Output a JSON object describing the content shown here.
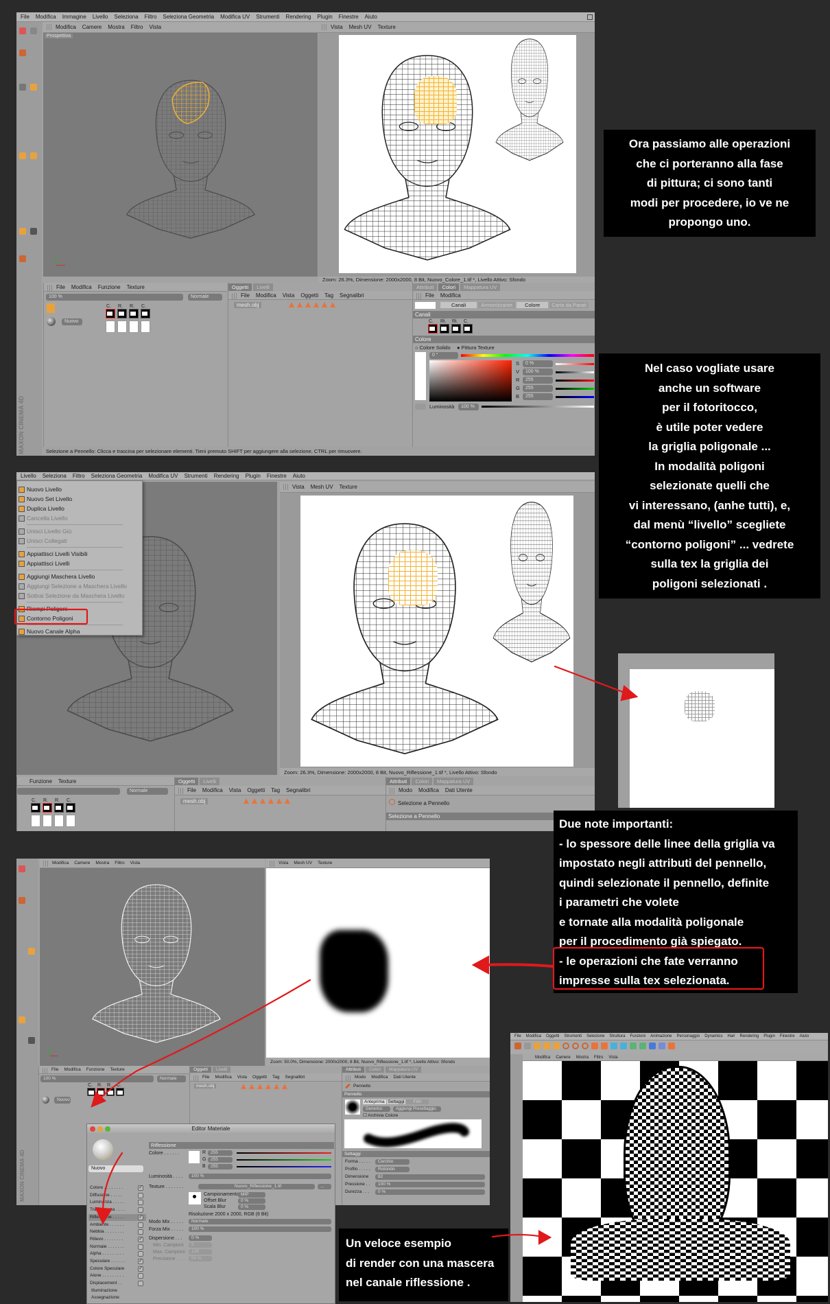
{
  "screen1": {
    "menubar": [
      "File",
      "Modifica",
      "Immagine",
      "Livello",
      "Seleziona",
      "Filtro",
      "Seleziona Geometria",
      "Modifica UV",
      "Strumenti",
      "Rendering",
      "Plugin",
      "Finestre",
      "Aiuto"
    ],
    "viewport_menu": [
      "Modifica",
      "Camere",
      "Mostra",
      "Filtro",
      "Vista"
    ],
    "viewport_label": "Prospettiva",
    "uv_menu": [
      "Vista",
      "Mesh UV",
      "Texture"
    ],
    "uv_status": "Zoom: 26.3%, Dimensione: 2000x2000, 8 Bit, Nuovo_Colore_1.tif *, Livello Attivo: Sfondo",
    "tex_menu": [
      "File",
      "Modifica",
      "Funzione",
      "Texture"
    ],
    "opacity": "100 %",
    "blend": "Normale",
    "material": "Nuovo",
    "channels": [
      "C.",
      "R.",
      "R.",
      "C."
    ],
    "obj_tabs": [
      "Oggetti",
      "Livelli"
    ],
    "obj_menu": [
      "File",
      "Modifica",
      "Vista",
      "Oggetti",
      "Tag",
      "Segnalibri"
    ],
    "object_name": "mesh.obj",
    "attr_tabs": [
      "Attributi",
      "Colori",
      "Mappatura UV"
    ],
    "attr_menu": [
      "File",
      "Modifica"
    ],
    "color_tabs": [
      "Canali",
      "Armonizzante",
      "Colore",
      "Carta da Parati"
    ],
    "canali_header": "Canali",
    "canali_channels": [
      "C.",
      "Ri.",
      "Ri.",
      "C."
    ],
    "colore_header": "Colore",
    "radio": [
      "Colore Solido",
      "Pittura Texture"
    ],
    "hue": "0 °",
    "sliders": [
      {
        "label": "S",
        "value": "0 %"
      },
      {
        "label": "V",
        "value": "100 %"
      },
      {
        "label": "R",
        "value": "255"
      },
      {
        "label": "G",
        "value": "255"
      },
      {
        "label": "B",
        "value": "255"
      }
    ],
    "luminosity_label": "Luminosità",
    "luminosity": "100 %",
    "statusbar": "Selezione a Pennello: Clicca e trascina per selezionare elementi. Tieni premuto SHIFT per aggiungere alla selezione, CTRL per rimuovere.",
    "brand": "MAXON CINEMA 4D"
  },
  "screen2": {
    "menubar": [
      "Livello",
      "Seleziona",
      "Filtro",
      "Seleziona Geometria",
      "Modifica UV",
      "Strumenti",
      "Rendering",
      "Plugin",
      "Finestre",
      "Aiuto"
    ],
    "layer_menu": [
      {
        "label": "Nuovo Livello",
        "enabled": true
      },
      {
        "label": "Nuovo Set Livello",
        "enabled": true
      },
      {
        "label": "Duplica Livello",
        "enabled": true
      },
      {
        "label": "Cancella Livello",
        "enabled": false
      },
      {
        "label": "Unisci Livello Giù",
        "enabled": false
      },
      {
        "label": "Unisci Collegati",
        "enabled": false
      },
      {
        "label": "Appiattisci Livelli Visibili",
        "enabled": true
      },
      {
        "label": "Appiattisci Livelli",
        "enabled": true
      },
      {
        "label": "Aggiungi Maschera Livello",
        "enabled": true
      },
      {
        "label": "Aggiungi Selezione a Maschera Livello",
        "enabled": false
      },
      {
        "label": "Sottrai Selezione da Maschera Livello",
        "enabled": false
      },
      {
        "label": "Riempi Poligoni",
        "enabled": true
      },
      {
        "label": "Contorno Poligoni",
        "enabled": true
      },
      {
        "label": "Nuovo Canale Alpha",
        "enabled": true
      }
    ],
    "uv_menu": [
      "Vista",
      "Mesh UV",
      "Texture"
    ],
    "uv_status": "Zoom: 26.3%, Dimensione: 2000x2000, 8 Bit, Nuovo_Riflessione_1.tif *, Livello Attivo: Sfondo",
    "tex_menu": [
      "Funzione",
      "Texture"
    ],
    "blend": "Normale",
    "channels": [
      "C.",
      "R.",
      "R.",
      "C."
    ],
    "obj_tabs": [
      "Oggetti",
      "Livelli"
    ],
    "obj_menu": [
      "File",
      "Modifica",
      "Vista",
      "Oggetti",
      "Tag",
      "Segnalibri"
    ],
    "object_name": "mesh.obj",
    "attr_tabs": [
      "Attributi",
      "Colori",
      "Mappatura UV"
    ],
    "attr_menu": [
      "Modo",
      "Modifica",
      "Dati Utente"
    ],
    "tool": "Selezione a Pennello",
    "tool_header": "Selezione a Pennello"
  },
  "screen3": {
    "viewport_menu": [
      "Modifica",
      "Camere",
      "Mostra",
      "Filtro",
      "Vista"
    ],
    "uv_menu": [
      "Vista",
      "Mesh UV",
      "Texture"
    ],
    "uv_status": "Zoom: 50.0%, Dimensione: 2000x2000, 8 Bit, Nuovo_Riflessione_1.tif *, Livello Attivo: Sfondo",
    "tex_menu": [
      "File",
      "Modifica",
      "Funzione",
      "Texture"
    ],
    "opacity": "100 %",
    "blend": "Normale",
    "material": "Nuovo",
    "channels": [
      "C.",
      "R.",
      "R.",
      "C."
    ],
    "obj_tabs": [
      "Oggetti",
      "Livelli"
    ],
    "obj_menu": [
      "File",
      "Modifica",
      "Vista",
      "Oggetti",
      "Tag",
      "Segnalibri"
    ],
    "object_name": "mesh.obj",
    "attr_tabs": [
      "Attributi",
      "Colori",
      "Mappatura UV"
    ],
    "attr_menu": [
      "Modo",
      "Modifica",
      "Dati Utente"
    ],
    "tool": "Pennello",
    "tool_header": "Pennello",
    "brush_tabs": [
      "Anteprima",
      "Settaggi",
      "Filtri"
    ],
    "preset": "Generico",
    "add_preset": "Aggiungi Presettaggio",
    "archive_color": "Archivia Colore",
    "settings_header": "Settaggi",
    "params": [
      {
        "label": "Forma . . . . .",
        "value": "Cerchio"
      },
      {
        "label": "Profilo . . . . .",
        "value": "Rotondo"
      },
      {
        "label": "Dimensione",
        "value": "82"
      },
      {
        "label": "Pressione . .",
        "value": "100 %"
      },
      {
        "label": "Durezza . . .",
        "value": "0 %"
      }
    ],
    "brand": "MAXON CINEMA 4D"
  },
  "material_editor": {
    "title": "Editor Materiale",
    "name": "Nuovo",
    "channels": [
      {
        "label": "Colore . . . . . . . .",
        "checked": true
      },
      {
        "label": "Diffusione . . . . .",
        "checked": false
      },
      {
        "label": "Luminanza . . . . .",
        "checked": false
      },
      {
        "label": "Trasparenza . . . .",
        "checked": false
      },
      {
        "label": "Riflessione . . . . .",
        "checked": true
      },
      {
        "label": "Ambiente . . . . . .",
        "checked": false
      },
      {
        "label": "Nebbia . . . . . . . .",
        "checked": false
      },
      {
        "label": "Rilievo . . . . . . . .",
        "checked": true
      },
      {
        "label": "Normale . . . . . . .",
        "checked": false
      },
      {
        "label": "Alpha . . . . . . . . .",
        "checked": false
      },
      {
        "label": "Speculare . . . . . .",
        "checked": true
      },
      {
        "label": "Colore Speculare",
        "checked": true
      },
      {
        "label": "Alone . . . . . . . . .",
        "checked": false
      },
      {
        "label": "Displacement . .",
        "checked": false
      }
    ],
    "extra": [
      "Illuminazione",
      "Assegnazione"
    ],
    "section": "Riflessione",
    "color_label": "Colore . . . . . .",
    "rgb": [
      {
        "label": "R",
        "value": "255"
      },
      {
        "label": "G",
        "value": "255"
      },
      {
        "label": "B",
        "value": "255"
      }
    ],
    "luminosity_label": "Luminosità . . . .",
    "luminosity": "100 %",
    "texture_label": "Texture . . . . . . .",
    "texture": "Nuovo_Riflessione_1.tif",
    "browse": "...",
    "sampling_label": "Campionamento",
    "sampling": "MIP",
    "offset_blur_label": "Offset Blur",
    "offset_blur": "0 %",
    "scale_blur_label": "Scala Blur",
    "scale_blur": "0 %",
    "resolution": "Risoluzione 2000 x 2000, RGB (8 Bit)",
    "mix_mode_label": "Modo Mix . . . . .",
    "mix_mode": "Normale",
    "mix_strength_label": "Forza Mix . . . . .",
    "mix_strength": "100 %",
    "dispersion_label": "Dispersione . . .",
    "dispersion": "0 %",
    "min_samples_label": "Min. Campioni",
    "min_samples": "5",
    "max_samples_label": "Max. Campioni",
    "max_samples": "128",
    "precision_label": "Precisione . . . .",
    "precision": "50 %"
  },
  "screen4": {
    "menubar": [
      "File",
      "Modifica",
      "Oggetti",
      "Strumenti",
      "Selezione",
      "Struttura",
      "Funzioni",
      "Animazione",
      "Personaggio",
      "Dynamics",
      "Hair",
      "Rendering",
      "Plugin",
      "Finestre",
      "Aiuto"
    ],
    "viewport_menu": [
      "Modifica",
      "Camere",
      "Mostra",
      "Filtro",
      "Vista"
    ]
  },
  "notes": {
    "note1": [
      "Ora passiamo alle operazioni",
      "che ci porteranno alla fase",
      "di pittura; ci sono tanti",
      "modi per procedere, io ve ne",
      "propongo uno."
    ],
    "note2": [
      "Nel caso vogliate usare",
      "anche un software",
      "per il fotoritocco,",
      "è utile poter vedere",
      "la griglia poligonale ...",
      "In modalità poligoni",
      "selezionate quelli che",
      "vi interessano, (anhe tutti), e,",
      "dal menù “livello” scegliete",
      "“contorno poligoni” ... vedrete",
      "sulla tex la griglia dei",
      "poligoni selezionati ."
    ],
    "note3": [
      "Due note importanti:",
      "- lo spessore delle linee della griglia va",
      "impostato negli attributi del pennello,",
      "quindi selezionate il pennello, definite",
      "i parametri che volete",
      "e tornate alla modalità poligonale",
      "per il procedimento già spiegato.",
      "- le operazioni che fate verranno",
      "impresse sulla tex selezionata."
    ],
    "note4": [
      "Un veloce esempio",
      "di render con una mascera",
      "nel  canale riflessione ."
    ]
  },
  "colors": {
    "background": "#2a2a2a",
    "annotation_red": "#e0191b",
    "selection_orange": "#f2b233",
    "ui_gray": "#a3a3a3"
  }
}
